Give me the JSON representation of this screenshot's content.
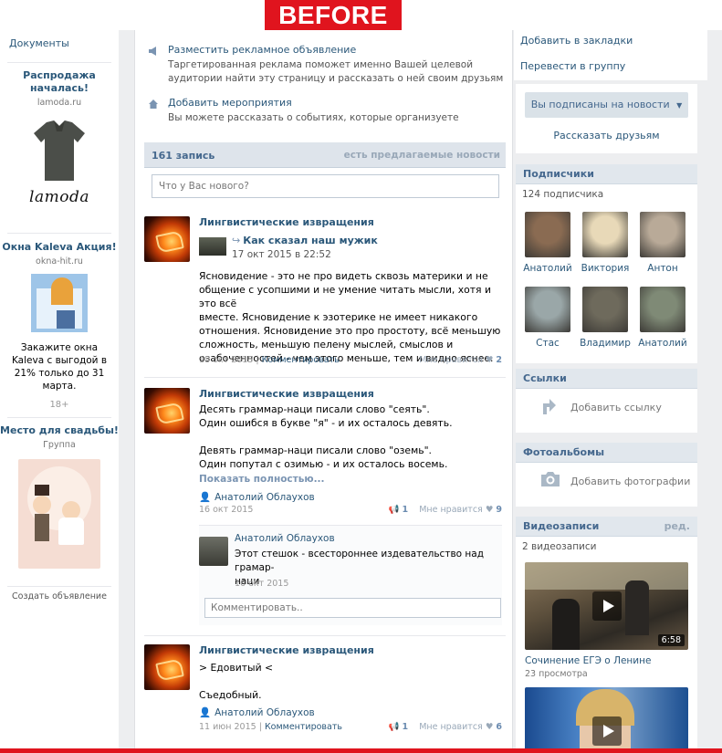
{
  "banner": {
    "label": "BEFORE"
  },
  "left": {
    "documents_link": "Документы",
    "ads": [
      {
        "title": "Распродажа началась!",
        "domain": "lamoda.ru",
        "logo_text": "lamoda"
      },
      {
        "title": "Окна Kaleva Акция!",
        "domain": "okna-hit.ru",
        "text": "Закажите окна Kaleva с выгодой в 21% только до 31 марта.",
        "age": "18+"
      },
      {
        "title": "Место для свадьбы!",
        "domain": "Группа"
      }
    ],
    "create_ad": "Создать объявление"
  },
  "actions": [
    {
      "icon": "megaphone-icon",
      "title": "Разместить рекламное объявление",
      "desc": "Таргетированная реклама поможет именно Вашей целевой аудитории найти эту страницу и рассказать о ней своим друзьям"
    },
    {
      "icon": "house-icon",
      "title": "Добавить мероприятия",
      "desc": "Вы можете рассказать о событиях, которые организуете"
    }
  ],
  "wall": {
    "count": "161 запись",
    "suggested": "есть предлагаемые новости",
    "placeholder": "Что у Вас нового?"
  },
  "posts": [
    {
      "author": "Лингвистические извращения",
      "repost_title": "Как сказал наш мужик",
      "repost_date": "17 окт 2015 в 22:52",
      "lines": [
        "Ясновидение - это не про видеть сквозь материки и не",
        "общение с усопшими и не умение читать мысли, хотя и это всё",
        "вместе. Ясновидение к эзотерике не имеет никакого",
        "отношения. Ясновидение это про простоту, всё меньшую",
        "сложность, меньшую пелену мыслей, смыслов и",
        "озабоченностей - чем этого меньше, тем и видно яснее."
      ],
      "date": "18 окт 2015",
      "comment": "Комментировать",
      "like_label": "Мне нравится",
      "likes": "2"
    },
    {
      "author": "Лингвистические извращения",
      "lines": [
        "Десять граммар-наци писали слово \"сеять\".",
        "Один ошибся в букве \"я\" - и их осталось девять.",
        "",
        "Девять граммар-наци писали слово \"оземь\".",
        "Один попутал с озимью - и их осталось восемь."
      ],
      "show_more": "Показать полностью...",
      "signer": "Анатолий Облаухов",
      "date": "16 окт 2015",
      "reposts": "1",
      "like_label": "Мне нравится",
      "likes": "9",
      "reply": {
        "name": "Анатолий Облаухов",
        "lines": [
          "Этот стешок - всестороннее издевательство над грамар-",
          "наци"
        ],
        "date": "16 окт 2015"
      },
      "comment_placeholder": "Комментировать.."
    },
    {
      "author": "Лингвистические извращения",
      "lines": [
        "> Едовитый <",
        "",
        "Съедобный."
      ],
      "signer": "Анатолий Облаухов",
      "date": "11 июн 2015",
      "comment": "Комментировать",
      "reposts": "1",
      "like_label": "Мне нравится",
      "likes": "6"
    }
  ],
  "right": {
    "bookmark": "Добавить в закладки",
    "to_group": "Перевести в группу",
    "subscribed_button": "Вы подписаны на новости",
    "tell_friends": "Рассказать друзьям",
    "subscribers": {
      "title": "Подписчики",
      "count": "124 подписчика",
      "people": [
        {
          "name": "Анатолий",
          "color": "#8a6b52"
        },
        {
          "name": "Виктория",
          "color": "#e8d9b8"
        },
        {
          "name": "Антон",
          "color": "#b9aa98"
        },
        {
          "name": "Стас",
          "color": "#9aa7a8"
        },
        {
          "name": "Владимир",
          "color": "#6e6a5c"
        },
        {
          "name": "Анатолий",
          "color": "#7f8a76"
        }
      ]
    },
    "links": {
      "title": "Ссылки",
      "add": "Добавить ссылку"
    },
    "albums": {
      "title": "Фотоальбомы",
      "add": "Добавить фотографии"
    },
    "videos": {
      "title": "Видеозаписи",
      "edit": "ред.",
      "count": "2 видеозаписи",
      "items": [
        {
          "title": "Сочинение ЕГЭ о Ленине",
          "views": "23 просмотра",
          "duration": "6:58"
        },
        {
          "title": "",
          "views": "",
          "duration": ""
        }
      ]
    }
  }
}
